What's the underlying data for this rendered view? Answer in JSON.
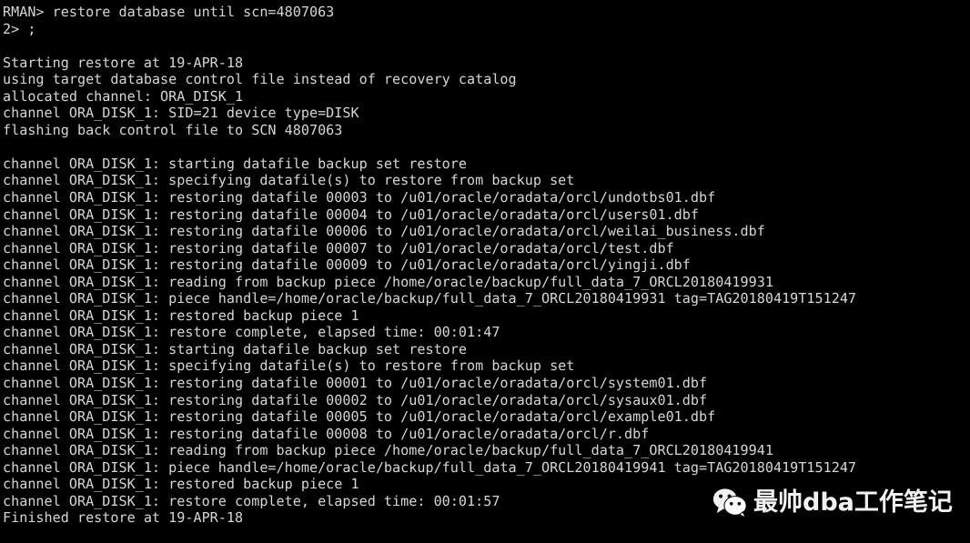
{
  "terminal": {
    "background_color": "#000000",
    "text_color": "#d6d6d6",
    "prompt": "RMAN>",
    "continuation_prompt": "2>",
    "lines": [
      "RMAN> restore database until scn=4807063",
      "2> ;",
      "",
      "Starting restore at 19-APR-18",
      "using target database control file instead of recovery catalog",
      "allocated channel: ORA_DISK_1",
      "channel ORA_DISK_1: SID=21 device type=DISK",
      "flashing back control file to SCN 4807063",
      "",
      "channel ORA_DISK_1: starting datafile backup set restore",
      "channel ORA_DISK_1: specifying datafile(s) to restore from backup set",
      "channel ORA_DISK_1: restoring datafile 00003 to /u01/oracle/oradata/orcl/undotbs01.dbf",
      "channel ORA_DISK_1: restoring datafile 00004 to /u01/oracle/oradata/orcl/users01.dbf",
      "channel ORA_DISK_1: restoring datafile 00006 to /u01/oracle/oradata/orcl/weilai_business.dbf",
      "channel ORA_DISK_1: restoring datafile 00007 to /u01/oracle/oradata/orcl/test.dbf",
      "channel ORA_DISK_1: restoring datafile 00009 to /u01/oracle/oradata/orcl/yingji.dbf",
      "channel ORA_DISK_1: reading from backup piece /home/oracle/backup/full_data_7_ORCL20180419931",
      "channel ORA_DISK_1: piece handle=/home/oracle/backup/full_data_7_ORCL20180419931 tag=TAG20180419T151247",
      "channel ORA_DISK_1: restored backup piece 1",
      "channel ORA_DISK_1: restore complete, elapsed time: 00:01:47",
      "channel ORA_DISK_1: starting datafile backup set restore",
      "channel ORA_DISK_1: specifying datafile(s) to restore from backup set",
      "channel ORA_DISK_1: restoring datafile 00001 to /u01/oracle/oradata/orcl/system01.dbf",
      "channel ORA_DISK_1: restoring datafile 00002 to /u01/oracle/oradata/orcl/sysaux01.dbf",
      "channel ORA_DISK_1: restoring datafile 00005 to /u01/oracle/oradata/orcl/example01.dbf",
      "channel ORA_DISK_1: restoring datafile 00008 to /u01/oracle/oradata/orcl/r.dbf",
      "channel ORA_DISK_1: reading from backup piece /home/oracle/backup/full_data_7_ORCL20180419941",
      "channel ORA_DISK_1: piece handle=/home/oracle/backup/full_data_7_ORCL20180419941 tag=TAG20180419T151247",
      "channel ORA_DISK_1: restored backup piece 1",
      "channel ORA_DISK_1: restore complete, elapsed time: 00:01:57",
      "Finished restore at 19-APR-18"
    ]
  },
  "watermark": {
    "icon": "wechat-icon",
    "text": "最帅dba工作笔记",
    "text_color": "#f2f2f2"
  }
}
